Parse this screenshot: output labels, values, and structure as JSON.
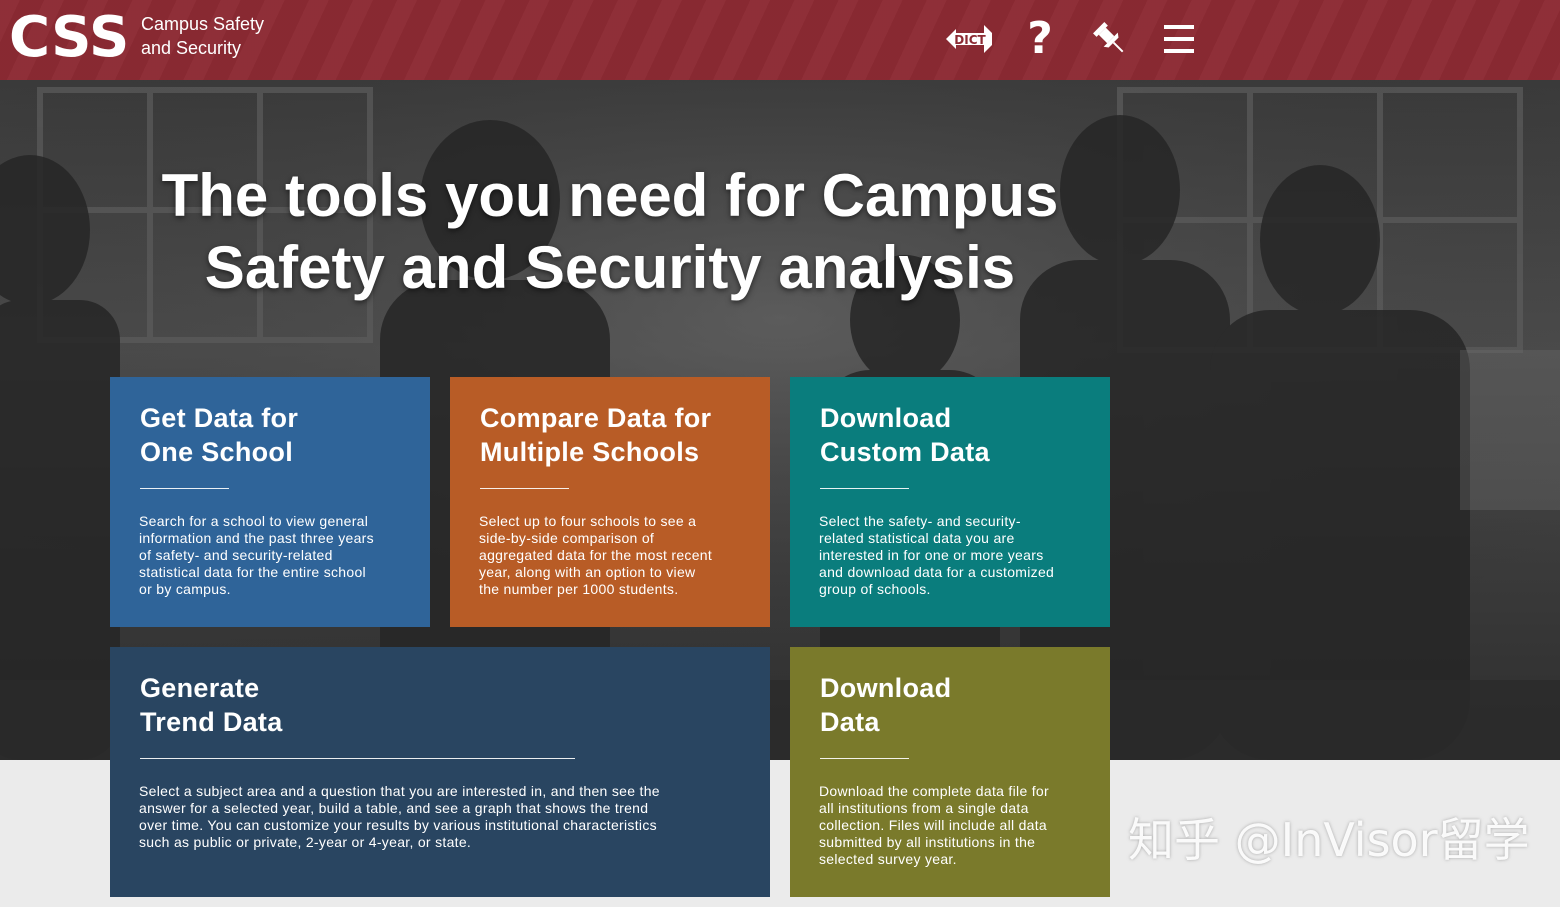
{
  "header": {
    "logo": "CSS",
    "subtitle_line1": "Campus Safety",
    "subtitle_line2": "and Security",
    "icons": [
      "dict-icon",
      "help-icon",
      "pin-icon",
      "menu-icon"
    ],
    "dict_label": "DICT",
    "help_label": "?"
  },
  "hero": {
    "title_line1": "The tools you need for Campus",
    "title_line2": "Safety and Security analysis"
  },
  "tiles": [
    {
      "title_line1": "Get Data for",
      "title_line2": "One School",
      "desc": [
        "Search for a school to view general",
        "information and the past three years",
        "of safety- and security-related",
        "statistical data for the entire school",
        "or by campus."
      ],
      "color": "#2f6499"
    },
    {
      "title_line1": "Compare Data for",
      "title_line2": "Multiple Schools",
      "desc": [
        "Select up to four schools to see a",
        "side-by-side comparison of",
        "aggregated data for the most recent",
        "year, along with an option to view",
        "the number per 1000 students."
      ],
      "color": "#b85c26"
    },
    {
      "title_line1": "Download",
      "title_line2": "Custom Data",
      "desc": [
        "Select the safety- and security-",
        "related statistical data you are",
        "interested in for one or more years",
        "and download data for a customized",
        "group of schools."
      ],
      "color": "#0a7d7d"
    },
    {
      "title_line1": "Generate",
      "title_line2": "Trend Data",
      "desc": [
        "Select a subject area and a question that you are interested in, and then see the",
        "answer for a selected year, build a table, and see a graph that shows the trend",
        "over time. You can customize your results by various institutional characteristics",
        "such as public or private, 2-year or 4-year, or state."
      ],
      "color": "#294561"
    },
    {
      "title_line1": "Download",
      "title_line2": "Data",
      "desc": [
        "Download the complete data file for",
        "all institutions from a single data",
        "collection. Files will include all data",
        "submitted by all institutions in the",
        "selected survey year."
      ],
      "color": "#7a7a2b"
    }
  ],
  "watermark": "知乎 @InVisor留学"
}
